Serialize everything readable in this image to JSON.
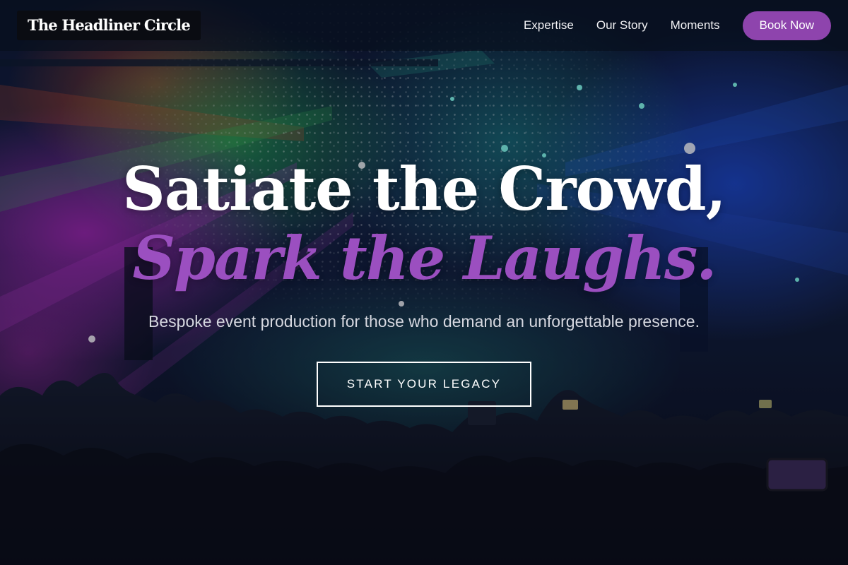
{
  "header": {
    "logo_text": "The Headliner Circle",
    "nav": [
      {
        "label": "Expertise"
      },
      {
        "label": "Our Story"
      },
      {
        "label": "Moments"
      }
    ],
    "cta_label": "Book Now"
  },
  "hero": {
    "headline_line1": "Satiate the Crowd,",
    "headline_line2": "Spark the Laughs.",
    "subtitle": "Bespoke event production for those who demand an unforgettable presence.",
    "cta_label": "START YOUR LEGACY",
    "background_image": "concert-crowd-photo"
  },
  "colors": {
    "accent": "#8e44ad",
    "headline_accent": "#9b4fc0",
    "header_bg": "#08101e",
    "logo_bg": "#0a0c12",
    "text": "#ffffff"
  }
}
